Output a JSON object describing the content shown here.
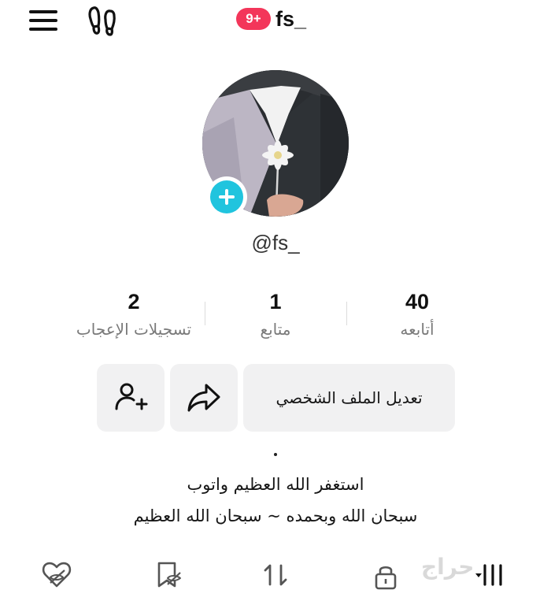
{
  "header": {
    "notification_badge": "9+",
    "title": "fs_"
  },
  "profile": {
    "handle": "@fs_"
  },
  "stats": [
    {
      "value": "2",
      "label": "تسجيلات الإعجاب"
    },
    {
      "value": "1",
      "label": "متابع"
    },
    {
      "value": "40",
      "label": "أتابعه"
    }
  ],
  "actions": {
    "edit_profile_label": "تعديل الملف الشخصي"
  },
  "bio": {
    "dot": ".",
    "line1": "استغفر الله العظيم واتوب",
    "line2": "سبحان الله وبحمده ~ سبحان الله العظيم"
  },
  "tabs": [
    "liked-hidden",
    "favorites-hidden",
    "reposts",
    "private-videos",
    "videos-grid"
  ],
  "watermark": "حراج",
  "colors": {
    "badge": "#f3365a",
    "add_button": "#20c4de",
    "button_bg": "#f1f1f2",
    "label_gray": "#7a7a7a"
  }
}
